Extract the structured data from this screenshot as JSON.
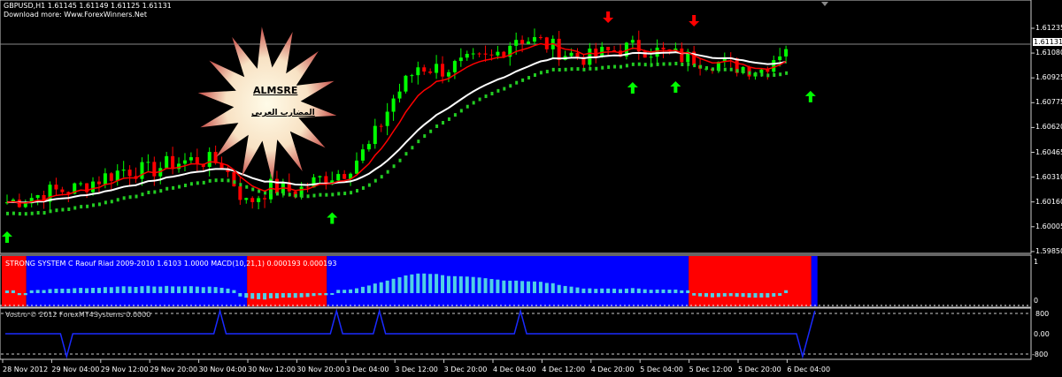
{
  "header": {
    "symbol_line": "GBPUSD,H1  1.61145 1.61149 1.61125 1.61131",
    "download_line": "Download more: Www.ForexWinners.Net"
  },
  "logo": {
    "title": "ALMSRE",
    "subtitle": "المضارب العربي"
  },
  "price_axis": {
    "labels": [
      "1.61235",
      "1.61080",
      "1.60925",
      "1.60775",
      "1.60620",
      "1.60465",
      "1.60310",
      "1.60160",
      "1.60005",
      "1.59850"
    ],
    "current_price": "1.61131"
  },
  "macd_pane": {
    "label": "STRONG SYSTEM C Raouf Riad 2009-2010  1.6103 1.0000  MACD(10,21,1) 0.000193 0.000193",
    "axis_labels": [
      "1",
      "0"
    ]
  },
  "vostro_pane": {
    "label": "Vostro © 2012 ForexMT4Systems    0.0000",
    "axis_labels": [
      "800",
      "0.00",
      "-800"
    ]
  },
  "time_axis": [
    "28 Nov 2012",
    "29 Nov 04:00",
    "29 Nov 12:00",
    "29 Nov 20:00",
    "30 Nov 04:00",
    "30 Nov 12:00",
    "30 Nov 20:00",
    "3 Dec 04:00",
    "3 Dec 12:00",
    "3 Dec 20:00",
    "4 Dec 04:00",
    "4 Dec 12:00",
    "4 Dec 20:00",
    "5 Dec 04:00",
    "5 Dec 12:00",
    "5 Dec 20:00",
    "6 Dec 04:00"
  ],
  "colors": {
    "bull": "#00ff00",
    "bear": "#ff0000",
    "fast_ma": "#ff0000",
    "slow_ma": "#ffffff",
    "dots": "#22cc22",
    "histogram": "#4fd0e6",
    "blue_zone": "#0000ff",
    "red_zone": "#ff0000",
    "vostro_line": "#1a2aff"
  },
  "chart_data": {
    "type": "candlestick",
    "symbol": "GBPUSD",
    "timeframe": "H1",
    "bars_per_anchor": 4,
    "anchor_closes": [
      1.6015,
      1.6018,
      1.6022,
      1.6024,
      1.603,
      1.6036,
      1.6035,
      1.604,
      1.6042,
      1.604,
      1.6015,
      1.6025,
      1.6022,
      1.603,
      1.6035,
      1.605,
      1.608,
      1.61,
      1.6098,
      1.6102,
      1.6105,
      1.6118,
      1.6115,
      1.6108,
      1.6105,
      1.611,
      1.6112,
      1.6108,
      1.6105,
      1.6103,
      1.61,
      1.6098,
      1.6113
    ],
    "ylim": [
      1.5978,
      1.6136
    ],
    "buy_arrows_bar": [
      0,
      53,
      102,
      109,
      131
    ],
    "sell_arrows_bar": [
      98,
      112
    ],
    "trend_zones": [
      {
        "state": "down",
        "from": 0,
        "to": 4
      },
      {
        "state": "up",
        "from": 4,
        "to": 40
      },
      {
        "state": "down",
        "from": 40,
        "to": 53
      },
      {
        "state": "up",
        "from": 53,
        "to": 112
      },
      {
        "state": "down",
        "from": 112,
        "to": 132
      },
      {
        "state": "up",
        "from": 132,
        "to": 133
      }
    ],
    "vostro_spikes_up_bar": [
      35,
      54,
      61,
      84,
      132
    ],
    "vostro_spikes_down_bar": [
      10,
      130
    ],
    "vostro_ylim": [
      -800,
      800
    ]
  }
}
